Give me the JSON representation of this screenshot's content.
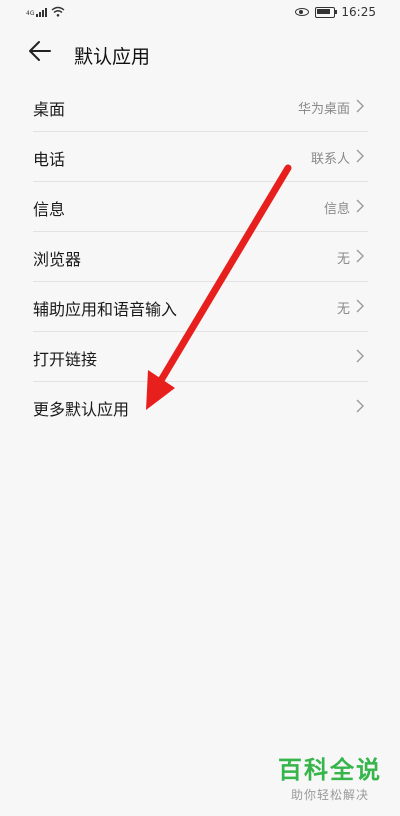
{
  "status_bar": {
    "network": "4G",
    "time": "16:25"
  },
  "header": {
    "title": "默认应用"
  },
  "settings": [
    {
      "label": "桌面",
      "value": "华为桌面"
    },
    {
      "label": "电话",
      "value": "联系人"
    },
    {
      "label": "信息",
      "value": "信息"
    },
    {
      "label": "浏览器",
      "value": "无"
    },
    {
      "label": "辅助应用和语音输入",
      "value": "无"
    },
    {
      "label": "打开链接",
      "value": ""
    },
    {
      "label": "更多默认应用",
      "value": ""
    }
  ],
  "annotation": {
    "arrow_color": "#e8201d"
  },
  "watermark": {
    "title": "百科全说",
    "subtitle": "助你轻松解决"
  }
}
